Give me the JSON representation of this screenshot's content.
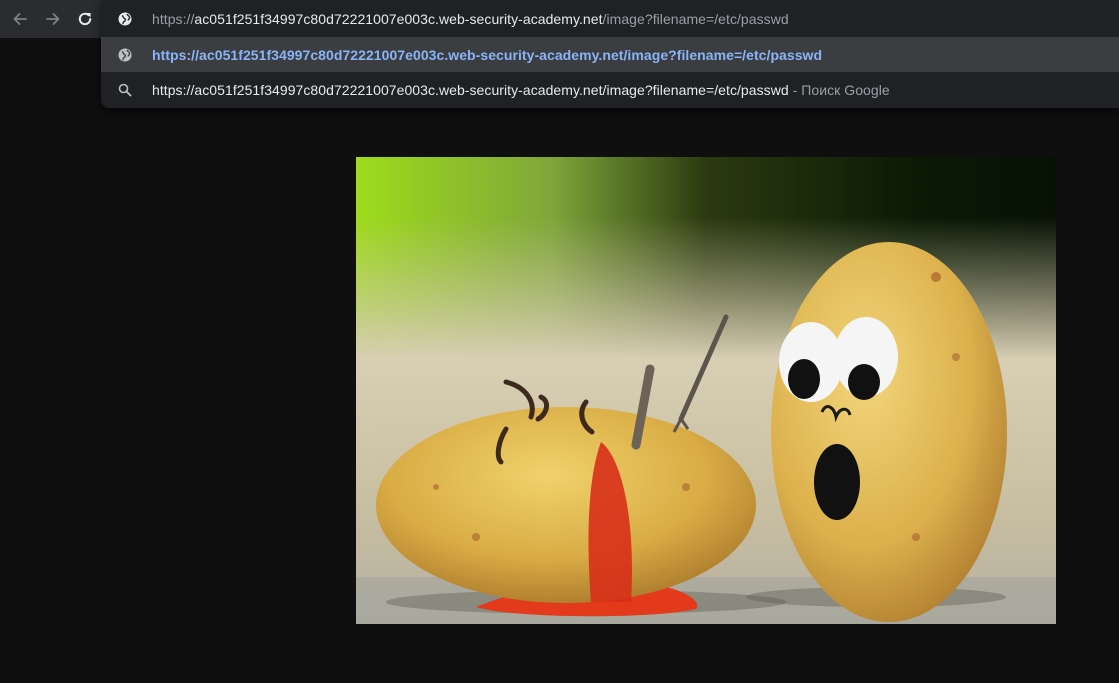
{
  "browser": {
    "nav": {
      "back_icon": "arrow-left-icon",
      "forward_icon": "arrow-right-icon",
      "reload_icon": "reload-icon"
    },
    "omnibox": {
      "input": {
        "scheme": "https://",
        "host": "ac051f251f34997c80d72221007e003c.web-security-academy.net",
        "path": "/image?filename=/etc/passwd"
      },
      "suggestions": [
        {
          "icon": "globe-icon",
          "text": "https://ac051f251f34997c80d72221007e003c.web-security-academy.net/image?filename=/etc/passwd",
          "selected": true
        },
        {
          "icon": "search-icon",
          "text": "https://ac051f251f34997c80d72221007e003c.web-security-academy.net/image?filename=/etc/passwd",
          "suffix": " - Поиск Google",
          "selected": false
        }
      ]
    }
  },
  "page": {
    "image_subject": "two-potatoes-photo",
    "colors": {
      "background": "#0f0f10",
      "toolbar": "#2b2c30",
      "dropdown": "#202124",
      "selected_row": "#3c3d41",
      "link_blue": "#8ab4f8"
    }
  }
}
